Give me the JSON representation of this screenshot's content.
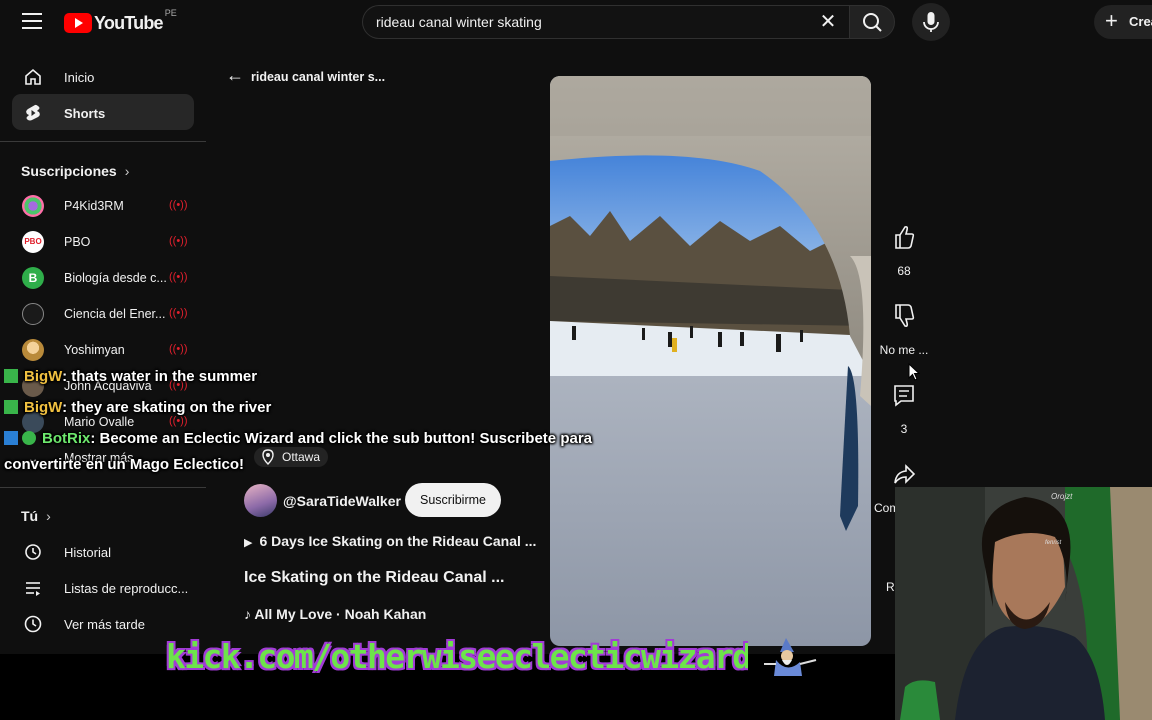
{
  "header": {
    "logo_text": "YouTube",
    "country_code": "PE",
    "search_value": "rideau canal winter skating",
    "create_label": "Crear"
  },
  "sidebar": {
    "nav": [
      {
        "label": "Inicio",
        "icon": "home-icon"
      },
      {
        "label": "Shorts",
        "icon": "shorts-icon",
        "active": true
      }
    ],
    "subscriptions_title": "Suscripciones",
    "subscriptions": [
      {
        "name": "P4Kid3RM"
      },
      {
        "name": "PBO",
        "avatar_text": "PBO"
      },
      {
        "name": "Biología desde c...",
        "avatar_text": "B"
      },
      {
        "name": "Ciencia del Ener..."
      },
      {
        "name": "Yoshimyan"
      },
      {
        "name": "John Acquaviva"
      },
      {
        "name": "Mario Ovalle"
      }
    ],
    "show_more": "Mostrar más",
    "you_title": "Tú",
    "you_items": [
      {
        "label": "Historial",
        "icon": "history-icon"
      },
      {
        "label": "Listas de reproducc...",
        "icon": "playlists-icon"
      },
      {
        "label": "Ver más tarde",
        "icon": "watch-later-icon"
      }
    ]
  },
  "main": {
    "back_title": "rideau canal winter s...",
    "location": "Ottawa",
    "channel": "@SaraTideWalker",
    "subscribe_label": "Suscribirme",
    "playlist": "6 Days Ice Skating on the Rideau Canal ...",
    "title": "Ice Skating on the Rideau Canal ...",
    "music": "All My Love · Noah Kahan"
  },
  "actions": {
    "likes": "68",
    "dislike_label": "No me ...",
    "comments": "3",
    "share_label": "Com",
    "remix_label": "R"
  },
  "chat": [
    {
      "user": "BigW",
      "message": ": thats water in the summer"
    },
    {
      "user": "BigW",
      "message": ": they are skating on the river"
    },
    {
      "user": "BotRix",
      "message": ": Become an Eclectic Wizard and click the sub button! Suscribete para",
      "continuation": "convertirte en un Mago Eclectico!"
    }
  ],
  "overlay": {
    "kick_url": "kick.com/otherwiseeclecticwizard",
    "webcam_tags": [
      "Orojzt",
      "fenrist"
    ]
  },
  "colors": {
    "background": "#0f0f0f",
    "brand_red": "#ff0000",
    "live_red": "#e0202d",
    "chat_user": "#f0c040",
    "kick_green": "#6de44a",
    "kick_outline": "#a23cd6"
  }
}
